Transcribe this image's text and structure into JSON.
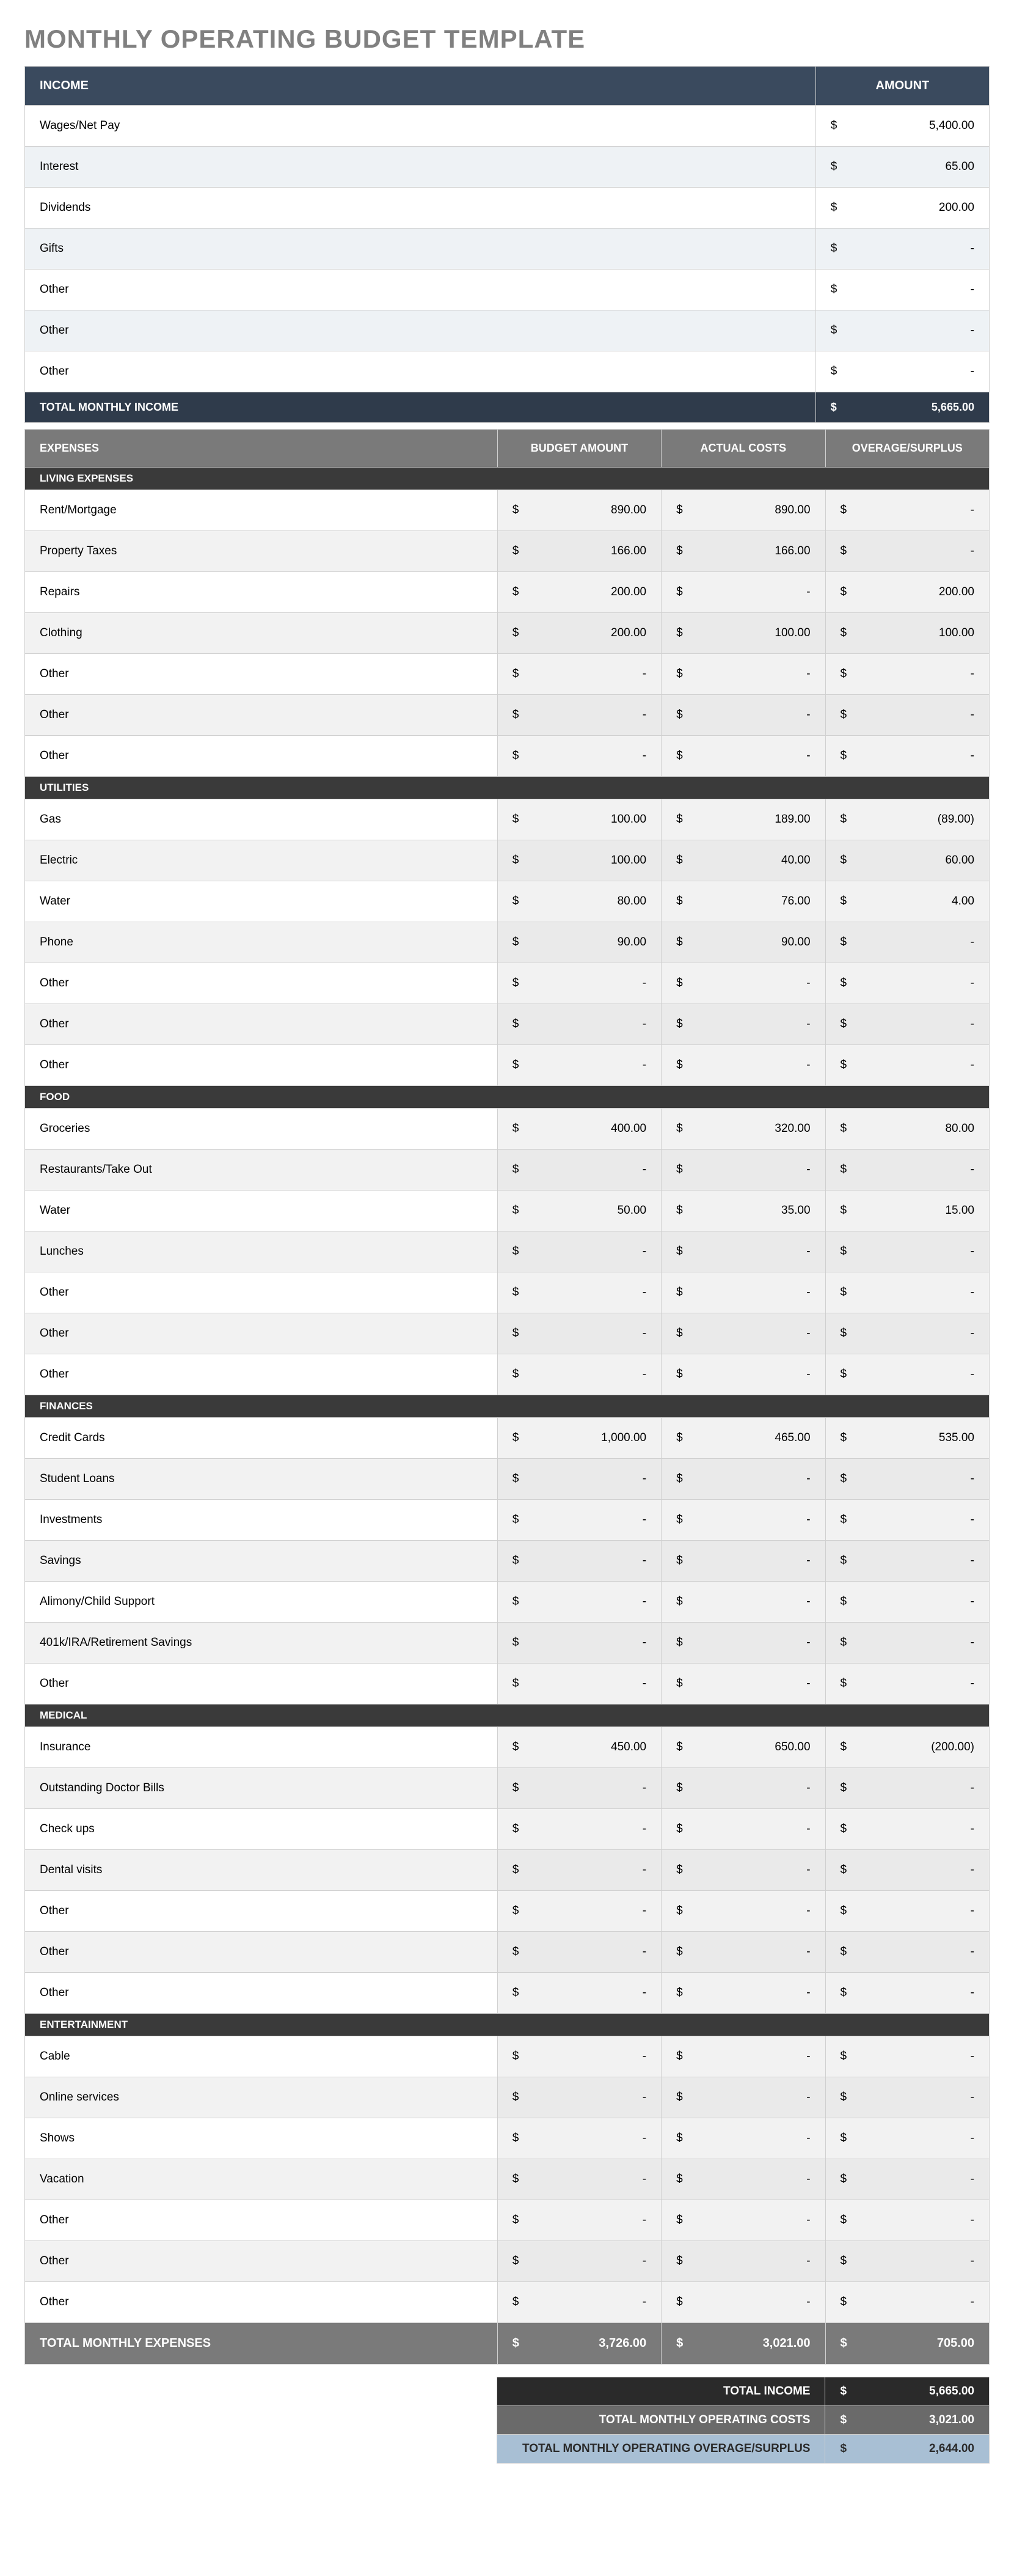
{
  "title": "MONTHLY OPERATING BUDGET TEMPLATE",
  "income": {
    "header_label": "INCOME",
    "header_amount": "AMOUNT",
    "rows": [
      {
        "label": "Wages/Net Pay",
        "amount": "5,400.00"
      },
      {
        "label": "Interest",
        "amount": "65.00"
      },
      {
        "label": "Dividends",
        "amount": "200.00"
      },
      {
        "label": "Gifts",
        "amount": "-"
      },
      {
        "label": "Other",
        "amount": "-"
      },
      {
        "label": "Other",
        "amount": "-"
      },
      {
        "label": "Other",
        "amount": "-"
      }
    ],
    "total_label": "TOTAL MONTHLY INCOME",
    "total_amount": "5,665.00"
  },
  "expenses": {
    "header_label": "EXPENSES",
    "header_budget": "BUDGET AMOUNT",
    "header_actual": "ACTUAL COSTS",
    "header_overage": "OVERAGE/SURPLUS",
    "categories": [
      {
        "name": "LIVING EXPENSES",
        "rows": [
          {
            "label": "Rent/Mortgage",
            "budget": "890.00",
            "actual": "890.00",
            "overage": "-"
          },
          {
            "label": "Property Taxes",
            "budget": "166.00",
            "actual": "166.00",
            "overage": "-"
          },
          {
            "label": "Repairs",
            "budget": "200.00",
            "actual": "-",
            "overage": "200.00"
          },
          {
            "label": "Clothing",
            "budget": "200.00",
            "actual": "100.00",
            "overage": "100.00"
          },
          {
            "label": "Other",
            "budget": "-",
            "actual": "-",
            "overage": "-"
          },
          {
            "label": "Other",
            "budget": "-",
            "actual": "-",
            "overage": "-"
          },
          {
            "label": "Other",
            "budget": "-",
            "actual": "-",
            "overage": "-"
          }
        ]
      },
      {
        "name": "UTILITIES",
        "rows": [
          {
            "label": "Gas",
            "budget": "100.00",
            "actual": "189.00",
            "overage": "(89.00)"
          },
          {
            "label": "Electric",
            "budget": "100.00",
            "actual": "40.00",
            "overage": "60.00"
          },
          {
            "label": "Water",
            "budget": "80.00",
            "actual": "76.00",
            "overage": "4.00"
          },
          {
            "label": "Phone",
            "budget": "90.00",
            "actual": "90.00",
            "overage": "-"
          },
          {
            "label": "Other",
            "budget": "-",
            "actual": "-",
            "overage": "-"
          },
          {
            "label": "Other",
            "budget": "-",
            "actual": "-",
            "overage": "-"
          },
          {
            "label": "Other",
            "budget": "-",
            "actual": "-",
            "overage": "-"
          }
        ]
      },
      {
        "name": "FOOD",
        "rows": [
          {
            "label": "Groceries",
            "budget": "400.00",
            "actual": "320.00",
            "overage": "80.00"
          },
          {
            "label": "Restaurants/Take Out",
            "budget": "-",
            "actual": "-",
            "overage": "-"
          },
          {
            "label": "Water",
            "budget": "50.00",
            "actual": "35.00",
            "overage": "15.00"
          },
          {
            "label": "Lunches",
            "budget": "-",
            "actual": "-",
            "overage": "-"
          },
          {
            "label": "Other",
            "budget": "-",
            "actual": "-",
            "overage": "-"
          },
          {
            "label": "Other",
            "budget": "-",
            "actual": "-",
            "overage": "-"
          },
          {
            "label": "Other",
            "budget": "-",
            "actual": "-",
            "overage": "-"
          }
        ]
      },
      {
        "name": "FINANCES",
        "rows": [
          {
            "label": "Credit Cards",
            "budget": "1,000.00",
            "actual": "465.00",
            "overage": "535.00"
          },
          {
            "label": "Student Loans",
            "budget": "-",
            "actual": "-",
            "overage": "-"
          },
          {
            "label": "Investments",
            "budget": "-",
            "actual": "-",
            "overage": "-"
          },
          {
            "label": "Savings",
            "budget": "-",
            "actual": "-",
            "overage": "-"
          },
          {
            "label": "Alimony/Child Support",
            "budget": "-",
            "actual": "-",
            "overage": "-"
          },
          {
            "label": "401k/IRA/Retirement Savings",
            "budget": "-",
            "actual": "-",
            "overage": "-"
          },
          {
            "label": "Other",
            "budget": "-",
            "actual": "-",
            "overage": "-"
          }
        ]
      },
      {
        "name": "MEDICAL",
        "rows": [
          {
            "label": "Insurance",
            "budget": "450.00",
            "actual": "650.00",
            "overage": "(200.00)"
          },
          {
            "label": "Outstanding Doctor Bills",
            "budget": "-",
            "actual": "-",
            "overage": "-"
          },
          {
            "label": "Check ups",
            "budget": "-",
            "actual": "-",
            "overage": "-"
          },
          {
            "label": "Dental visits",
            "budget": "-",
            "actual": "-",
            "overage": "-"
          },
          {
            "label": "Other",
            "budget": "-",
            "actual": "-",
            "overage": "-"
          },
          {
            "label": "Other",
            "budget": "-",
            "actual": "-",
            "overage": "-"
          },
          {
            "label": "Other",
            "budget": "-",
            "actual": "-",
            "overage": "-"
          }
        ]
      },
      {
        "name": "ENTERTAINMENT",
        "rows": [
          {
            "label": "Cable",
            "budget": "-",
            "actual": "-",
            "overage": "-"
          },
          {
            "label": "Online services",
            "budget": "-",
            "actual": "-",
            "overage": "-"
          },
          {
            "label": "Shows",
            "budget": "-",
            "actual": "-",
            "overage": "-"
          },
          {
            "label": "Vacation",
            "budget": "-",
            "actual": "-",
            "overage": "-"
          },
          {
            "label": "Other",
            "budget": "-",
            "actual": "-",
            "overage": "-"
          },
          {
            "label": "Other",
            "budget": "-",
            "actual": "-",
            "overage": "-"
          },
          {
            "label": "Other",
            "budget": "-",
            "actual": "-",
            "overage": "-"
          }
        ]
      }
    ],
    "total_label": "TOTAL MONTHLY EXPENSES",
    "total_budget": "3,726.00",
    "total_actual": "3,021.00",
    "total_overage": "705.00"
  },
  "summary": {
    "rows": [
      {
        "label": "TOTAL INCOME",
        "amount": "5,665.00"
      },
      {
        "label": "TOTAL MONTHLY OPERATING COSTS",
        "amount": "3,021.00"
      },
      {
        "label": "TOTAL MONTHLY OPERATING OVERAGE/SURPLUS",
        "amount": "2,644.00"
      }
    ]
  },
  "currency_symbol": "$"
}
